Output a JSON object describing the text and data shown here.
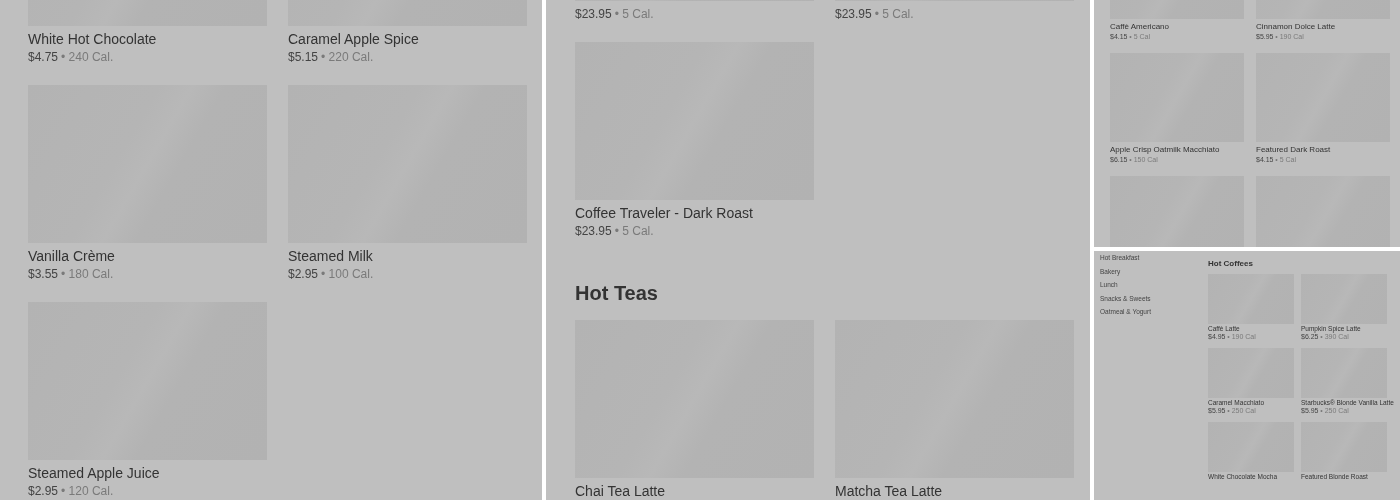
{
  "screens": [
    {
      "sections": [
        {
          "items": [
            {
              "kind": "product",
              "name": "White Hot Chocolate",
              "price": "$4.75",
              "calories": "• 240 Cal."
            },
            {
              "kind": "product",
              "name": "Caramel Apple Spice",
              "price": "$5.15",
              "calories": "• 220 Cal."
            },
            {
              "kind": "product",
              "name": "Vanilla Crème",
              "price": "$3.55",
              "calories": "• 180 Cal."
            },
            {
              "kind": "product",
              "name": "Steamed Milk",
              "price": "$2.95",
              "calories": "• 100 Cal."
            },
            {
              "kind": "product",
              "name": "Steamed Apple Juice",
              "price": "$2.95",
              "calories": "• 120 Cal."
            }
          ]
        }
      ]
    },
    {
      "sections": [
        {
          "items": [
            {
              "kind": "product",
              "price": "$23.95",
              "calories": "• 5 Cal."
            },
            {
              "kind": "product",
              "price": "$23.95",
              "calories": "• 5 Cal."
            },
            {
              "kind": "product",
              "name": "Coffee Traveler - Dark Roast",
              "price": "$23.95",
              "calories": "• 5 Cal."
            }
          ]
        },
        {
          "heading": "Hot Teas",
          "items": [
            {
              "kind": "product",
              "name": "Chai Tea Latte"
            },
            {
              "kind": "product",
              "name": "Matcha Tea Latte"
            }
          ]
        }
      ]
    },
    {
      "sections": [
        {
          "items": [
            {
              "kind": "product",
              "name": "Caffè Americano",
              "price": "$4.15",
              "calories": "• 5 Cal"
            },
            {
              "kind": "product",
              "name": "Cinnamon Dolce Latte",
              "price": "$5.95",
              "calories": "• 190 Cal"
            },
            {
              "kind": "product",
              "name": "Apple Crisp Oatmilk Macchiato",
              "price": "$6.15",
              "calories": "• 150 Cal"
            },
            {
              "kind": "product",
              "name": "Featured Dark Roast",
              "price": "$4.15",
              "calories": "• 5 Cal"
            },
            {
              "kind": "image-only"
            },
            {
              "kind": "image-only"
            }
          ]
        }
      ]
    },
    {
      "sidebar": [
        "Hot Breakfast",
        "Bakery",
        "Lunch",
        "Snacks & Sweets",
        "Oatmeal & Yogurt"
      ],
      "sections": [
        {
          "heading": "Hot Coffees",
          "items": [
            {
              "kind": "product",
              "name": "Caffè Latte",
              "price": "$4.95",
              "calories": "• 190 Cal"
            },
            {
              "kind": "product",
              "name": "Pumpkin Spice Latte",
              "price": "$6.25",
              "calories": "• 390 Cal"
            },
            {
              "kind": "product",
              "name": "Caramel Macchiato",
              "price": "$5.95",
              "calories": "• 250 Cal"
            },
            {
              "kind": "product",
              "name": "Starbucks® Blonde Vanilla Latte",
              "price": "$5.95",
              "calories": "• 250 Cal"
            },
            {
              "kind": "product",
              "name": "White Chocolate Mocha"
            },
            {
              "kind": "product",
              "name": "Featured Blonde Roast"
            }
          ]
        }
      ]
    }
  ]
}
